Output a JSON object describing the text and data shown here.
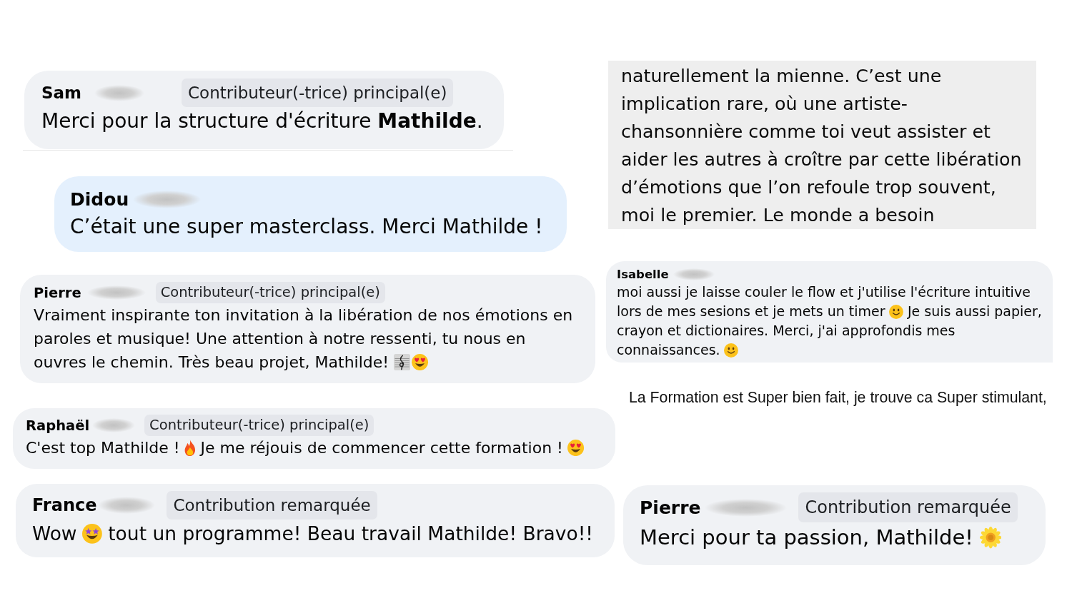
{
  "pieces": [
    {
      "kind": "comment",
      "author": "Sam",
      "badge": "Contributeur(-trice) principal(e)",
      "highlighted": false,
      "message": [
        {
          "kind": "text",
          "text": "Merci pour la structure d'écriture **Mathilde**."
        }
      ]
    },
    {
      "kind": "comment",
      "author": "Didou",
      "highlighted": true,
      "message": [
        {
          "kind": "text",
          "text": "C’était une super masterclass. Merci Mathilde !"
        }
      ]
    },
    {
      "kind": "comment",
      "author": "Pierre",
      "badge": "Contributeur(-trice) principal(e)",
      "highlighted": false,
      "message": [
        {
          "kind": "text",
          "text": "Vraiment inspirante ton invitation à la libération de nos émotions en paroles et musique! Une attention à notre ressenti, tu nous en ouvres le chemin. Très beau projet, Mathilde!"
        },
        {
          "kind": "score"
        },
        {
          "kind": "hearteyes"
        }
      ]
    },
    {
      "kind": "comment",
      "author": "Raphaël",
      "badge": "Contributeur(-trice) principal(e)",
      "highlighted": false,
      "message": [
        {
          "kind": "text",
          "text": "C'est top Mathilde !"
        },
        {
          "kind": "fire"
        },
        {
          "kind": "text",
          "text": "Je me réjouis de commencer cette formation !"
        },
        {
          "kind": "hearteyes"
        }
      ]
    },
    {
      "kind": "comment",
      "author": "France",
      "badge": "Contribution remarquée",
      "highlighted": false,
      "message": [
        {
          "kind": "text",
          "text": "Wow"
        },
        {
          "kind": "starstruck"
        },
        {
          "kind": "text",
          "text": "tout un programme! Beau travail Mathilde! Bravo!!"
        }
      ]
    },
    {
      "kind": "excerpt",
      "text": "naturellement la mienne. C’est une implication rare, où une artiste-chansonnière comme toi veut assister et aider les autres à croître par cette libération d’émotions que l’on refoule trop souvent, moi le premier. Le monde a besoin"
    },
    {
      "kind": "comment",
      "author": "Isabelle",
      "highlighted": false,
      "message": [
        {
          "kind": "text",
          "text": "moi aussi je laisse couler le flow et j'utilise l'écriture intuitive lors de mes sesions et je mets un timer"
        },
        {
          "kind": "smile"
        },
        {
          "kind": "text",
          "text": "Je suis aussi papier, crayon et dictionaires. Merci, j'ai approfondis mes connaissances."
        },
        {
          "kind": "smile"
        }
      ]
    },
    {
      "kind": "note",
      "text": "La Formation est Super bien fait, je trouve ca Super stimulant,"
    },
    {
      "kind": "comment",
      "author": "Pierre",
      "badge": "Contribution remarquée",
      "highlighted": false,
      "message": [
        {
          "kind": "text",
          "text": "Merci pour ta passion, Mathilde!"
        },
        {
          "kind": "sunflower"
        }
      ]
    }
  ]
}
